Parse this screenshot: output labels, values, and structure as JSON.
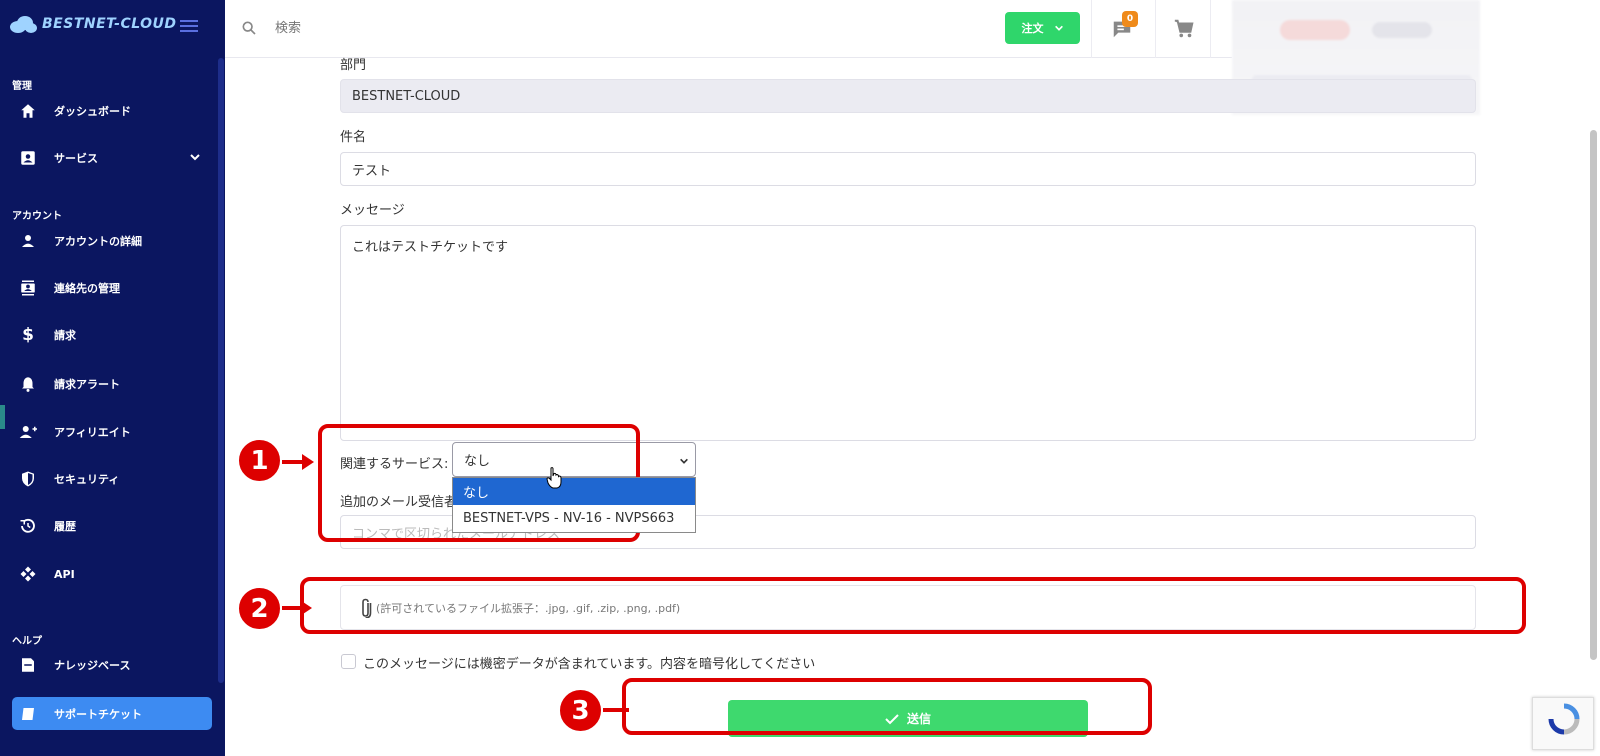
{
  "sidebar": {
    "brand": "BESTNET-CLOUD",
    "sections": {
      "manage": "管理",
      "account": "アカウント",
      "help": "ヘルプ"
    },
    "items": [
      {
        "label": "ダッシュボード",
        "icon": "home-icon"
      },
      {
        "label": "サービス",
        "icon": "service-icon"
      },
      {
        "label": "アカウントの詳細",
        "icon": "person-icon"
      },
      {
        "label": "連絡先の管理",
        "icon": "contacts-icon"
      },
      {
        "label": "請求",
        "icon": "dollar-icon"
      },
      {
        "label": "請求アラート",
        "icon": "bell-icon"
      },
      {
        "label": "アフィリエイト",
        "icon": "person-add-icon"
      },
      {
        "label": "セキュリティ",
        "icon": "shield-icon"
      },
      {
        "label": "履歴",
        "icon": "history-icon"
      },
      {
        "label": "API",
        "icon": "api-icon"
      },
      {
        "label": "ナレッジベース",
        "icon": "book-icon"
      },
      {
        "label": "サポートチケット",
        "icon": "ticket-icon"
      }
    ]
  },
  "topbar": {
    "search_placeholder": "検索",
    "order_label": "注文",
    "notification_count": "0"
  },
  "form": {
    "department_label": "部門",
    "department_value": "BESTNET-CLOUD",
    "subject_label": "件名",
    "subject_value": "テスト",
    "message_label": "メッセージ",
    "message_value": "これはテストチケットです",
    "related_service_label": "関連するサービス:",
    "related_service_value": "なし",
    "service_options": [
      "なし",
      "BESTNET-VPS - NV-16 - NVPS663"
    ],
    "email_label": "追加のメール受信者",
    "email_placeholder": "コンマで区切られたメールアドレス",
    "attachment_hint": "(許可されているファイル拡張子：.jpg, .gif, .zip, .png, .pdf)",
    "sensitive_checkbox_label": "このメッセージには機密データが含まれています。内容を暗号化してください",
    "submit_label": "送信"
  },
  "annotations": [
    "1",
    "2",
    "3"
  ],
  "colors": {
    "sidebar_bg": "#0b1660",
    "active_item": "#3d8bf2",
    "green_button": "#2fd66b",
    "annotation_red": "#dd0000",
    "badge_orange": "#ef8a1a"
  }
}
